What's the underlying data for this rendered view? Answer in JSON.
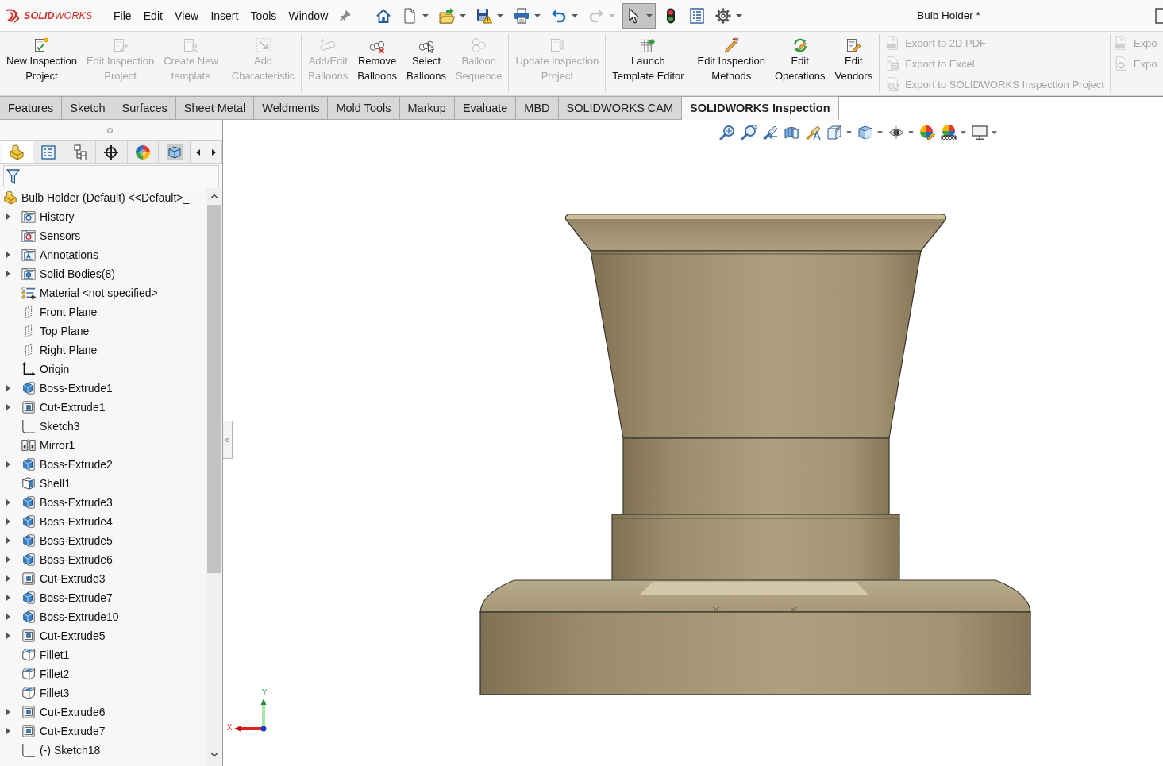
{
  "app": {
    "logo": "**SOLID**WORKS"
  },
  "menu": [
    "File",
    "Edit",
    "View",
    "Insert",
    "Tools",
    "Window"
  ],
  "quick_access": [
    {
      "kind": "home",
      "dropdown": false,
      "disabled": false,
      "pressed": false
    },
    {
      "kind": "new",
      "dropdown": true,
      "disabled": false,
      "pressed": false
    },
    {
      "kind": "open",
      "dropdown": true,
      "disabled": false,
      "pressed": false
    },
    {
      "kind": "save",
      "dropdown": true,
      "disabled": false,
      "pressed": false
    },
    {
      "kind": "print",
      "dropdown": true,
      "disabled": false,
      "pressed": false
    },
    {
      "kind": "undo",
      "dropdown": true,
      "disabled": false,
      "pressed": false
    },
    {
      "kind": "redo",
      "dropdown": true,
      "disabled": true,
      "pressed": false
    },
    {
      "kind": "select",
      "dropdown": true,
      "disabled": false,
      "pressed": true
    },
    {
      "kind": "rebuild",
      "dropdown": false,
      "disabled": false,
      "pressed": false
    },
    {
      "kind": "file_properties",
      "dropdown": false,
      "disabled": false,
      "pressed": false
    },
    {
      "kind": "options",
      "dropdown": true,
      "disabled": false,
      "pressed": false
    }
  ],
  "document_title": "Bulb Holder *",
  "ribbon": [
    {
      "kind": "large",
      "buttons": [
        {
          "kind": "new_project",
          "label": "New Inspection\nProject",
          "disabled": false
        },
        {
          "kind": "edit_project",
          "label": "Edit Inspection\nProject",
          "disabled": true
        },
        {
          "kind": "create_template",
          "label": "Create New\ntemplate",
          "disabled": true
        }
      ]
    },
    {
      "kind": "large",
      "buttons": [
        {
          "kind": "add_characteristic",
          "label": "Add\nCharacteristic",
          "disabled": true
        }
      ]
    },
    {
      "kind": "large",
      "buttons": [
        {
          "kind": "add_balloons",
          "label": "Add/Edit\nBalloons",
          "disabled": true
        },
        {
          "kind": "remove_balloons",
          "label": "Remove\nBalloons",
          "disabled": false
        },
        {
          "kind": "select_balloons",
          "label": "Select\nBalloons",
          "disabled": false
        },
        {
          "kind": "balloon_sequence",
          "label": "Balloon\nSequence",
          "disabled": true
        }
      ]
    },
    {
      "kind": "large",
      "buttons": [
        {
          "kind": "update_project",
          "label": "Update Inspection\nProject",
          "disabled": true
        }
      ]
    },
    {
      "kind": "large",
      "buttons": [
        {
          "kind": "launch_template",
          "label": "Launch\nTemplate Editor",
          "disabled": false
        }
      ]
    },
    {
      "kind": "large",
      "buttons": [
        {
          "kind": "edit_methods",
          "label": "Edit Inspection\nMethods",
          "disabled": false
        },
        {
          "kind": "edit_operations",
          "label": "Edit\nOperations",
          "disabled": false
        },
        {
          "kind": "edit_vendors",
          "label": "Edit\nVendors",
          "disabled": false
        }
      ]
    },
    {
      "kind": "small",
      "buttons": [
        {
          "kind": "export_pdf",
          "label": "Export to 2D PDF",
          "disabled": true
        },
        {
          "kind": "export_excel",
          "label": "Export to Excel",
          "disabled": true
        },
        {
          "kind": "export_project",
          "label": "Export to SOLIDWORKS Inspection Project",
          "disabled": true
        }
      ]
    },
    {
      "kind": "small",
      "buttons": [
        {
          "kind": "export_3d_pdf",
          "label": "Expo",
          "disabled": true
        },
        {
          "kind": "export_file",
          "label": "Expo",
          "disabled": true
        }
      ]
    }
  ],
  "tabs": [
    {
      "label": "Features",
      "selected": false
    },
    {
      "label": "Sketch",
      "selected": false
    },
    {
      "label": "Surfaces",
      "selected": false
    },
    {
      "label": "Sheet Metal",
      "selected": false
    },
    {
      "label": "Weldments",
      "selected": false
    },
    {
      "label": "Mold Tools",
      "selected": false
    },
    {
      "label": "Markup",
      "selected": false
    },
    {
      "label": "Evaluate",
      "selected": false
    },
    {
      "label": "MBD",
      "selected": false
    },
    {
      "label": "SOLIDWORKS CAM",
      "selected": false
    },
    {
      "label": "SOLIDWORKS Inspection",
      "selected": true
    }
  ],
  "panel": {
    "tabs": [
      {
        "kind": "feature_manager",
        "selected": true
      },
      {
        "kind": "property_manager",
        "selected": false
      },
      {
        "kind": "configuration_manager",
        "selected": false
      },
      {
        "kind": "dimxpert",
        "selected": false
      },
      {
        "kind": "display_manager",
        "selected": false
      },
      {
        "kind": "cam",
        "selected": false
      }
    ],
    "tree": {
      "kind": "part",
      "label": "Bulb Holder (Default) <<Default>_",
      "children": [
        {
          "label": "History",
          "kind": "history",
          "expandable": true
        },
        {
          "label": "Sensors",
          "kind": "sensors",
          "expandable": false
        },
        {
          "label": "Annotations",
          "kind": "annotations",
          "expandable": true
        },
        {
          "label": "Solid Bodies(8)",
          "kind": "solid_bodies",
          "expandable": true
        },
        {
          "label": "Material <not specified>",
          "kind": "material",
          "expandable": false
        },
        {
          "label": "Front Plane",
          "kind": "plane",
          "expandable": false
        },
        {
          "label": "Top Plane",
          "kind": "plane",
          "expandable": false
        },
        {
          "label": "Right Plane",
          "kind": "plane",
          "expandable": false
        },
        {
          "label": "Origin",
          "kind": "origin",
          "expandable": false
        },
        {
          "label": "Boss-Extrude1",
          "kind": "boss",
          "expandable": true
        },
        {
          "label": "Cut-Extrude1",
          "kind": "cut",
          "expandable": true
        },
        {
          "label": "Sketch3",
          "kind": "sketch",
          "expandable": false
        },
        {
          "label": "Mirror1",
          "kind": "mirror",
          "expandable": false
        },
        {
          "label": "Boss-Extrude2",
          "kind": "boss",
          "expandable": true
        },
        {
          "label": "Shell1",
          "kind": "shell",
          "expandable": false
        },
        {
          "label": "Boss-Extrude3",
          "kind": "boss",
          "expandable": true
        },
        {
          "label": "Boss-Extrude4",
          "kind": "boss",
          "expandable": true
        },
        {
          "label": "Boss-Extrude5",
          "kind": "boss",
          "expandable": true
        },
        {
          "label": "Boss-Extrude6",
          "kind": "boss",
          "expandable": true
        },
        {
          "label": "Cut-Extrude3",
          "kind": "cut",
          "expandable": true
        },
        {
          "label": "Boss-Extrude7",
          "kind": "boss",
          "expandable": true
        },
        {
          "label": "Boss-Extrude10",
          "kind": "boss",
          "expandable": true
        },
        {
          "label": "Cut-Extrude5",
          "kind": "cut",
          "expandable": true
        },
        {
          "label": "Fillet1",
          "kind": "fillet",
          "expandable": false
        },
        {
          "label": "Fillet2",
          "kind": "fillet",
          "expandable": false
        },
        {
          "label": "Fillet3",
          "kind": "fillet",
          "expandable": false
        },
        {
          "label": "Cut-Extrude6",
          "kind": "cut",
          "expandable": true
        },
        {
          "label": "Cut-Extrude7",
          "kind": "cut",
          "expandable": true
        },
        {
          "label": "(-) Sketch18",
          "kind": "sketch",
          "expandable": false
        }
      ]
    }
  },
  "view_toolbar": [
    {
      "kind": "zoom_to_fit",
      "dropdown": false
    },
    {
      "kind": "zoom_to_area",
      "dropdown": false
    },
    {
      "kind": "previous_view",
      "dropdown": false
    },
    {
      "kind": "section_view",
      "dropdown": false
    },
    {
      "kind": "dynamic_annotation",
      "dropdown": false
    },
    {
      "kind": "view_orientation",
      "dropdown": true
    },
    {
      "kind": "display_style",
      "dropdown": true
    },
    {
      "kind": "hide_show",
      "dropdown": true
    },
    {
      "kind": "edit_appearance",
      "dropdown": false
    },
    {
      "kind": "apply_scene",
      "dropdown": true
    },
    {
      "kind": "view_settings",
      "dropdown": true
    }
  ],
  "triad": {
    "x_label": "X",
    "y_label": "Y"
  }
}
